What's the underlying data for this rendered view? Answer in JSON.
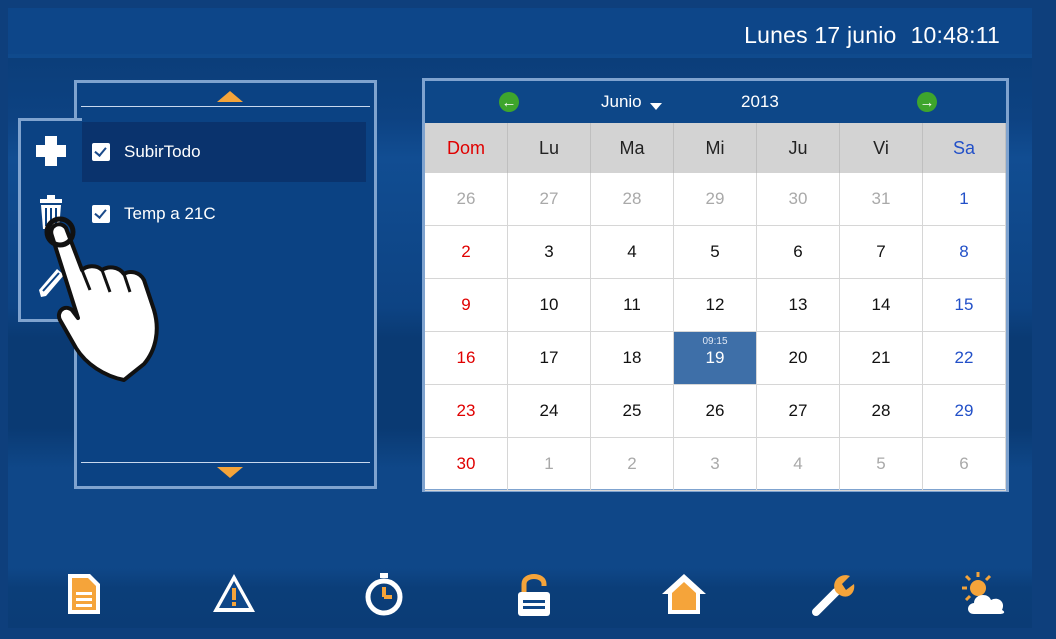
{
  "header": {
    "date": "Lunes 17 junio",
    "time": "10:48:11"
  },
  "list": {
    "items": [
      {
        "label": "SubirTodo",
        "checked": true,
        "selected": true
      },
      {
        "label": "Temp a 21C",
        "checked": true,
        "selected": false
      }
    ],
    "tools": [
      "plus-icon",
      "trash-icon",
      "pencil-icon"
    ]
  },
  "calendar": {
    "month": "Junio",
    "year": "2013",
    "weekdays": [
      "Dom",
      "Lu",
      "Ma",
      "Mi",
      "Ju",
      "Vi",
      "Sa"
    ],
    "weeks": [
      [
        "26",
        "27",
        "28",
        "29",
        "30",
        "31",
        "1"
      ],
      [
        "2",
        "3",
        "4",
        "5",
        "6",
        "7",
        "8"
      ],
      [
        "9",
        "10",
        "11",
        "12",
        "13",
        "14",
        "15"
      ],
      [
        "16",
        "17",
        "18",
        "19",
        "20",
        "21",
        "22"
      ],
      [
        "23",
        "24",
        "25",
        "26",
        "27",
        "28",
        "29"
      ],
      [
        "30",
        "1",
        "2",
        "3",
        "4",
        "5",
        "6"
      ]
    ],
    "selected_day": "19",
    "selected_event_time": "09:15"
  },
  "toolbar": {
    "icons": [
      "document-icon",
      "warning-icon",
      "timer-icon",
      "unlock-icon",
      "home-icon",
      "wrench-icon",
      "weather-icon"
    ]
  },
  "colors": {
    "background": "#0e3f7c",
    "accent_orange": "#f5a43a",
    "nav_green": "#3ea52c",
    "sunday": "#e00000",
    "saturday": "#2250c8",
    "selected_day": "#3e6fa8"
  }
}
